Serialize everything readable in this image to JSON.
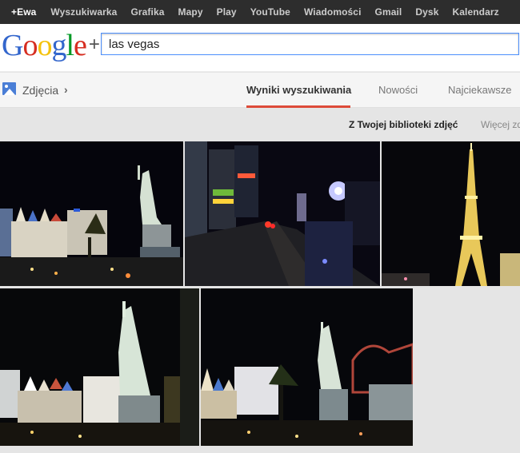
{
  "top_bar": {
    "items": [
      "+Ewa",
      "Wyszukiwarka",
      "Grafika",
      "Mapy",
      "Play",
      "YouTube",
      "Wiadomości",
      "Gmail",
      "Dysk",
      "Kalendarz"
    ]
  },
  "header": {
    "logo": {
      "letters": [
        "G",
        "o",
        "o",
        "g",
        "l",
        "e"
      ],
      "plus": "+"
    },
    "search_value": "las vegas"
  },
  "subnav": {
    "section_label": "Zdjęcia",
    "section_chevron": "›",
    "tabs": [
      {
        "label": "Wyniki wyszukiwania",
        "active": true
      },
      {
        "label": "Nowości",
        "active": false
      },
      {
        "label": "Najciekawsze",
        "active": false
      }
    ]
  },
  "filters": {
    "active": "Z Twojej biblioteki zdjęć",
    "more": "Więcej zd"
  },
  "photos": [
    {
      "icon": "statue-of-liberty-casino-photo"
    },
    {
      "icon": "strip-street-night-photo"
    },
    {
      "icon": "eiffel-tower-replica-photo"
    },
    {
      "icon": "statue-of-liberty-closeup-photo"
    },
    {
      "icon": "statue-of-liberty-skyline-photo"
    }
  ],
  "colors": {
    "accent_underline": "#dd4b39",
    "search_border": "#4d90fe",
    "top_bar_bg": "#2d2d2d"
  }
}
